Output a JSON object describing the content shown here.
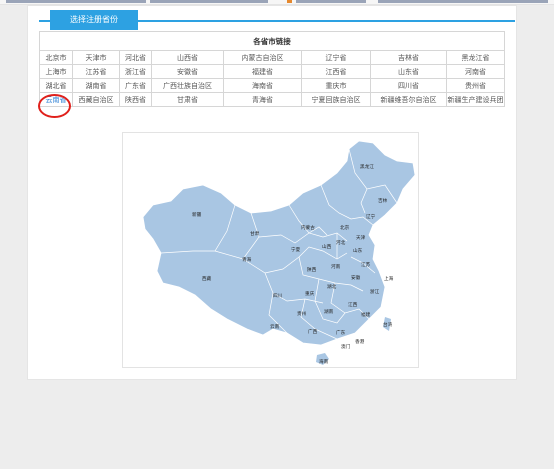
{
  "tab": {
    "label": "选择注册省份"
  },
  "table": {
    "header": "各省市链接",
    "rows": [
      [
        "北京市",
        "天津市",
        "河北省",
        "山西省",
        "内蒙古自治区",
        "辽宁省",
        "吉林省",
        "黑龙江省"
      ],
      [
        "上海市",
        "江苏省",
        "浙江省",
        "安徽省",
        "福建省",
        "江西省",
        "山东省",
        "河南省"
      ],
      [
        "湖北省",
        "湖南省",
        "广东省",
        "广西壮族自治区",
        "海南省",
        "重庆市",
        "四川省",
        "贵州省"
      ],
      [
        "云南省",
        "西藏自治区",
        "陕西省",
        "甘肃省",
        "青海省",
        "宁夏回族自治区",
        "新疆维吾尔自治区",
        "新疆生产建设兵团"
      ]
    ]
  },
  "map": {
    "fill_color": "#a9c6e3",
    "labels": {
      "heilongjiang": "黑龙江",
      "jilin": "吉林",
      "liaoning": "辽宁",
      "neimenggu": "内蒙古",
      "beijing": "北京",
      "tianjin": "天津",
      "hebei": "河北",
      "shanxi": "山西",
      "shandong": "山东",
      "xinjiang": "新疆",
      "gansu": "甘肃",
      "ningxia": "宁夏",
      "shaanxi": "陕西",
      "henan": "河南",
      "jiangsu": "江苏",
      "qinghai": "青海",
      "anhui": "安徽",
      "shanghai": "上海",
      "hubei": "湖北",
      "zhejiang": "浙江",
      "xizang": "西藏",
      "sichuan": "四川",
      "chongqing": "重庆",
      "jiangxi": "江西",
      "hunan": "湖南",
      "fujian": "福建",
      "guizhou": "贵州",
      "taiwan": "台湾",
      "yunnan": "云南",
      "guangxi": "广西",
      "guangdong": "广东",
      "hongkong": "香港",
      "macau": "澳门",
      "hainan": "海南"
    }
  }
}
